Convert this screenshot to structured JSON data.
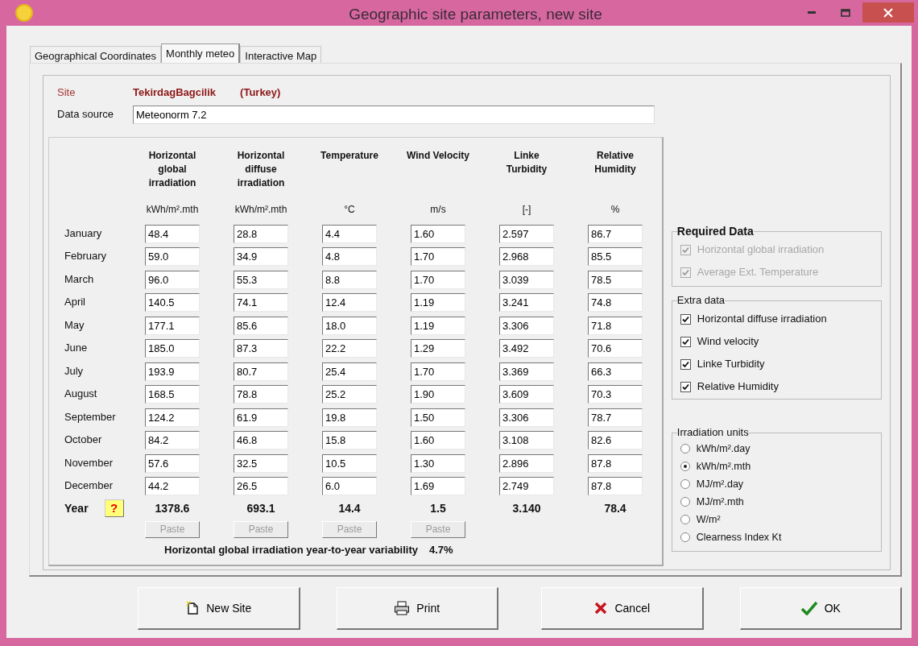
{
  "window": {
    "title": "Geographic site parameters, new site"
  },
  "tabs": [
    {
      "label": "Geographical Coordinates",
      "selected": false
    },
    {
      "label": "Monthly meteo",
      "selected": true
    },
    {
      "label": "Interactive Map",
      "selected": false
    }
  ],
  "site": {
    "label": "Site",
    "name": "TekirdagBagcilik",
    "country": "(Turkey)"
  },
  "data_source": {
    "label": "Data source",
    "value": "Meteonorm 7.2"
  },
  "table": {
    "columns": [
      {
        "heading": "Horizontal global irradiation",
        "unit": "kWh/m².mth",
        "year": "1378.6",
        "paste": {
          "label": "Paste",
          "disabled": true
        }
      },
      {
        "heading": "Horizontal diffuse irradiation",
        "unit": "kWh/m².mth",
        "year": "693.1",
        "paste": {
          "label": "Paste",
          "disabled": true
        }
      },
      {
        "heading": "Temperature",
        "unit": "°C",
        "year": "14.4",
        "paste": {
          "label": "Paste",
          "disabled": true
        }
      },
      {
        "heading": "Wind Velocity",
        "unit": "m/s",
        "year": "1.5",
        "paste": {
          "label": "Paste",
          "disabled": true
        }
      },
      {
        "heading": "Linke Turbidity",
        "unit": "[-]",
        "year": "3.140"
      },
      {
        "heading": "Relative Humidity",
        "unit": "%",
        "year": "78.4"
      }
    ],
    "rows": [
      {
        "month": "January",
        "values": [
          "48.4",
          "28.8",
          "4.4",
          "1.60",
          "2.597",
          "86.7"
        ]
      },
      {
        "month": "February",
        "values": [
          "59.0",
          "34.9",
          "4.8",
          "1.70",
          "2.968",
          "85.5"
        ]
      },
      {
        "month": "March",
        "values": [
          "96.0",
          "55.3",
          "8.8",
          "1.70",
          "3.039",
          "78.5"
        ]
      },
      {
        "month": "April",
        "values": [
          "140.5",
          "74.1",
          "12.4",
          "1.19",
          "3.241",
          "74.8"
        ]
      },
      {
        "month": "May",
        "values": [
          "177.1",
          "85.6",
          "18.0",
          "1.19",
          "3.306",
          "71.8"
        ]
      },
      {
        "month": "June",
        "values": [
          "185.0",
          "87.3",
          "22.2",
          "1.29",
          "3.492",
          "70.6"
        ]
      },
      {
        "month": "July",
        "values": [
          "193.9",
          "80.7",
          "25.4",
          "1.70",
          "3.369",
          "66.3"
        ]
      },
      {
        "month": "August",
        "values": [
          "168.5",
          "78.8",
          "25.2",
          "1.90",
          "3.609",
          "70.3"
        ]
      },
      {
        "month": "September",
        "values": [
          "124.2",
          "61.9",
          "19.8",
          "1.50",
          "3.306",
          "78.7"
        ]
      },
      {
        "month": "October",
        "values": [
          "84.2",
          "46.8",
          "15.8",
          "1.60",
          "3.108",
          "82.6"
        ]
      },
      {
        "month": "November",
        "values": [
          "57.6",
          "32.5",
          "10.5",
          "1.30",
          "2.896",
          "87.8"
        ]
      },
      {
        "month": "December",
        "values": [
          "44.2",
          "26.5",
          "6.0",
          "1.69",
          "2.749",
          "87.8"
        ]
      }
    ],
    "year_label": "Year",
    "help": "?"
  },
  "variability": {
    "label": "Horizontal global irradiation year-to-year variability",
    "value": "4.7%"
  },
  "required_data": {
    "title": "Required Data",
    "items": [
      {
        "label": "Horizontal global irradiation",
        "checked": true,
        "disabled": true
      },
      {
        "label": "Average Ext. Temperature",
        "checked": true,
        "disabled": true
      }
    ]
  },
  "extra_data": {
    "title": "Extra data",
    "items": [
      {
        "label": "Horizontal diffuse irradiation",
        "checked": true,
        "disabled": false
      },
      {
        "label": "Wind velocity",
        "checked": true,
        "disabled": false
      },
      {
        "label": "Linke Turbidity",
        "checked": true,
        "disabled": false
      },
      {
        "label": "Relative Humidity",
        "checked": true,
        "disabled": false
      }
    ]
  },
  "irradiation_units": {
    "title": "Irradiation units",
    "options": [
      {
        "label": "kWh/m².day",
        "selected": false
      },
      {
        "label": "kWh/m².mth",
        "selected": true
      },
      {
        "label": "MJ/m².day",
        "selected": false
      },
      {
        "label": "MJ/m².mth",
        "selected": false
      },
      {
        "label": "W/m²",
        "selected": false
      },
      {
        "label": "Clearness Index Kt",
        "selected": false
      }
    ]
  },
  "buttons": [
    {
      "kind": "new",
      "label": "New Site"
    },
    {
      "kind": "print",
      "label": "Print"
    },
    {
      "kind": "cancel",
      "label": "Cancel"
    },
    {
      "kind": "ok",
      "label": "OK"
    }
  ]
}
